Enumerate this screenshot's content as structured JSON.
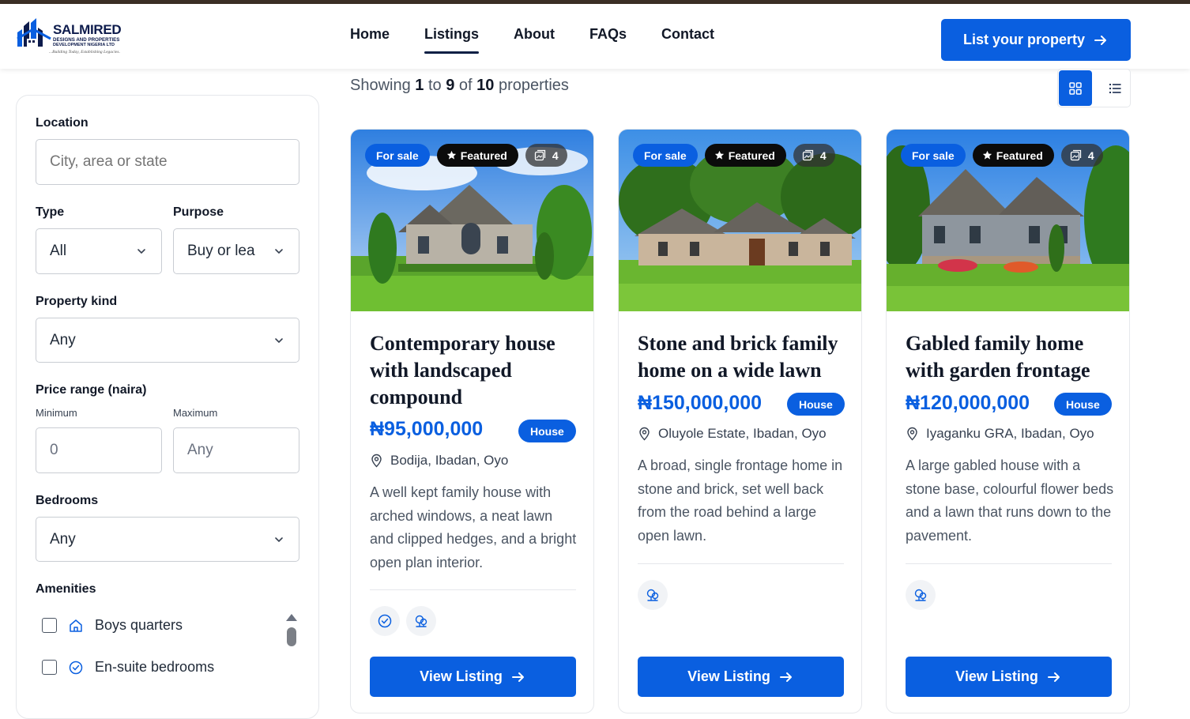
{
  "brand": {
    "name": "SALMIRED",
    "line1": "DESIGNS AND PROPERTIES",
    "line2": "DEVELOPMENT NIGERIA LTD",
    "tagline": "...Building Today, Establishing Legacies."
  },
  "nav": {
    "items": [
      {
        "label": "Home",
        "active": false
      },
      {
        "label": "Listings",
        "active": true
      },
      {
        "label": "About",
        "active": false
      },
      {
        "label": "FAQs",
        "active": false
      },
      {
        "label": "Contact",
        "active": false
      }
    ],
    "cta_label": "List your property"
  },
  "filters": {
    "location_label": "Location",
    "location_placeholder": "City, area or state",
    "type_label": "Type",
    "type_value": "All",
    "purpose_label": "Purpose",
    "purpose_value": "Buy or lea",
    "kind_label": "Property kind",
    "kind_value": "Any",
    "price_label": "Price range (naira)",
    "min_label": "Minimum",
    "min_value": "0",
    "max_label": "Maximum",
    "max_value": "Any",
    "bedrooms_label": "Bedrooms",
    "bedrooms_value": "Any",
    "amenities_label": "Amenities",
    "amenities": [
      {
        "label": "Boys quarters",
        "icon": "home-icon",
        "checked": false
      },
      {
        "label": "En-suite bedrooms",
        "icon": "check-circle-icon",
        "checked": false
      }
    ]
  },
  "results": {
    "prefix": "Showing",
    "from": "1",
    "to_word": "to",
    "to": "9",
    "of_word": "of",
    "total": "10",
    "suffix": "properties",
    "view_mode": "grid"
  },
  "accent_color": "#0a5fe0",
  "listings": [
    {
      "status": "For sale",
      "featured": "Featured",
      "image_count": "4",
      "title": "Contemporary house with landscaped compound",
      "price": "₦95,000,000",
      "kind": "House",
      "location": "Bodija, Ibadan, Oyo",
      "description": "A well kept family house with arched windows, a neat lawn and clipped hedges, and a bright open plan interior.",
      "amenity_icons": [
        "check-circle-icon",
        "trees-icon"
      ],
      "button": "View Listing"
    },
    {
      "status": "For sale",
      "featured": "Featured",
      "image_count": "4",
      "title": "Stone and brick family home on a wide lawn",
      "price": "₦150,000,000",
      "kind": "House",
      "location": "Oluyole Estate, Ibadan, Oyo",
      "description": "A broad, single frontage home in stone and brick, set well back from the road behind a large open lawn.",
      "amenity_icons": [
        "trees-icon"
      ],
      "button": "View Listing"
    },
    {
      "status": "For sale",
      "featured": "Featured",
      "image_count": "4",
      "title": "Gabled family home with garden frontage",
      "price": "₦120,000,000",
      "kind": "House",
      "location": "Iyaganku GRA, Ibadan, Oyo",
      "description": "A large gabled house with a stone base, colourful flower beds and a lawn that runs down to the pavement.",
      "amenity_icons": [
        "trees-icon"
      ],
      "button": "View Listing"
    }
  ]
}
